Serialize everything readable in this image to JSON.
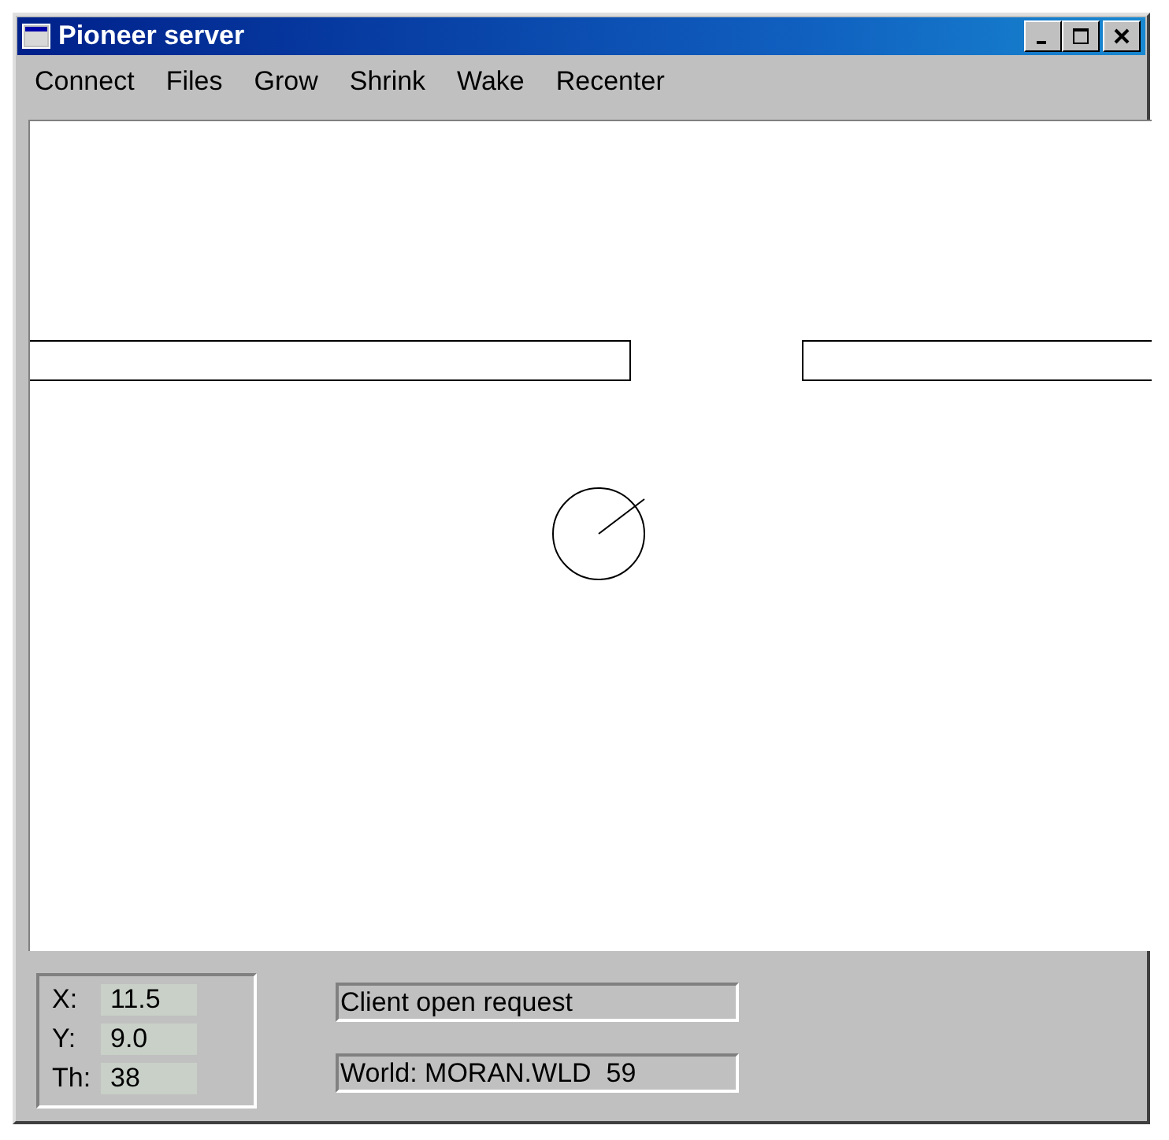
{
  "window": {
    "title": "Pioneer server"
  },
  "menu": [
    "Connect",
    "Files",
    "Grow",
    "Shrink",
    "Wake",
    "Recenter"
  ],
  "position": [
    {
      "label": "X:",
      "value": "11.5"
    },
    {
      "label": "Y:",
      "value": "9.0"
    },
    {
      "label": "Th:",
      "value": "38"
    }
  ],
  "status_lines": [
    "Client open request",
    "World: MORAN.WLD  59"
  ]
}
